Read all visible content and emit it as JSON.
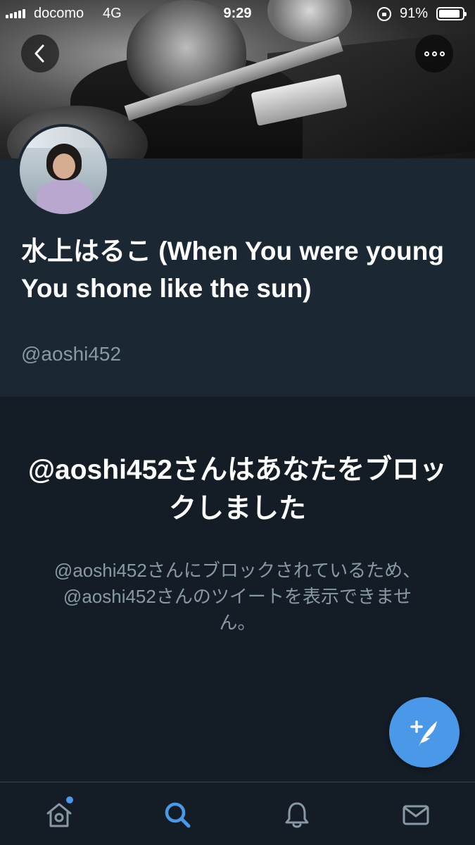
{
  "status_bar": {
    "carrier": "docomo",
    "network": "4G",
    "time": "9:29",
    "battery_percent": "91%",
    "battery_level": 0.91
  },
  "header": {
    "back_icon": "chevron-left-icon",
    "more_icon": "more-horizontal-icon"
  },
  "profile": {
    "display_name": "水上はるこ (When You were young You shone like the sun)",
    "handle": "@aoshi452"
  },
  "blocked": {
    "title": "@aoshi452さんはあなたをブロックしました",
    "description": "@aoshi452さんにブロックされているため、@aoshi452さんのツイートを表示できません。"
  },
  "fab": {
    "icon": "compose-tweet-icon"
  },
  "tabbar": {
    "tabs": [
      {
        "name": "home",
        "icon": "home-icon",
        "has_notification_dot": true
      },
      {
        "name": "search",
        "icon": "search-icon",
        "active": true
      },
      {
        "name": "notifications",
        "icon": "bell-icon"
      },
      {
        "name": "messages",
        "icon": "envelope-icon"
      }
    ]
  },
  "colors": {
    "background": "#141d26",
    "profile_background": "#1b2733",
    "accent": "#4a99e9",
    "secondary_text": "#8899a6"
  }
}
